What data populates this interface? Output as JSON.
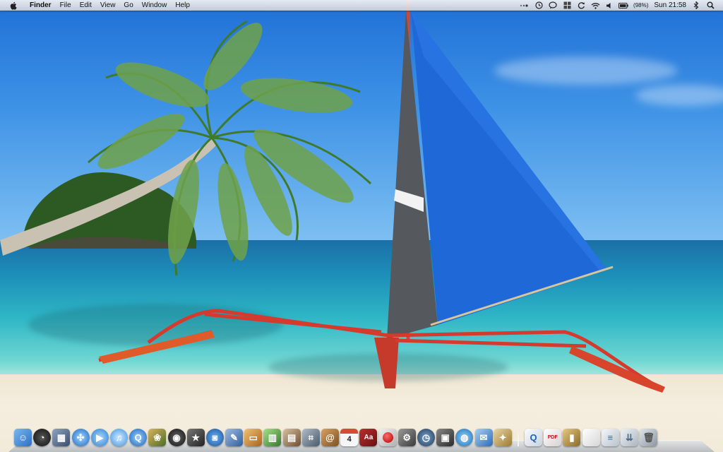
{
  "menubar": {
    "apple_icon": "apple-logo-icon",
    "app_name": "Finder",
    "menus": [
      "File",
      "Edit",
      "View",
      "Go",
      "Window",
      "Help"
    ],
    "status": {
      "battery_percent": "(98%)",
      "clock": "Sun 21:58",
      "icons": [
        "time-machine-icon",
        "chat-bubble-icon",
        "grid-icon",
        "sync-icon",
        "wifi-icon",
        "volume-icon",
        "battery-icon",
        "bluetooth-icon",
        "spotlight-search-icon"
      ]
    }
  },
  "wallpaper": {
    "description_icon": "beach-sailboat-wallpaper"
  },
  "dock": {
    "apps": [
      {
        "name": "finder",
        "icon": "finder-icon",
        "color": "#4a90d9"
      },
      {
        "name": "dashboard",
        "icon": "dashboard-icon",
        "color": "#2b2b2b"
      },
      {
        "name": "mission-control",
        "icon": "mission-control-icon",
        "color": "#5a6e8a"
      },
      {
        "name": "safari",
        "icon": "safari-icon",
        "color": "#3a8fd6"
      },
      {
        "name": "facetime",
        "icon": "facetime-icon",
        "color": "#4aa3e0"
      },
      {
        "name": "itunes",
        "icon": "itunes-icon",
        "color": "#53a6e8"
      },
      {
        "name": "quicktime",
        "icon": "quicktime-icon",
        "color": "#2a7fd0"
      },
      {
        "name": "iphoto",
        "icon": "iphoto-icon",
        "color": "#5b7f3a"
      },
      {
        "name": "aperture",
        "icon": "aperture-icon",
        "color": "#222222"
      },
      {
        "name": "imovie",
        "icon": "imovie-icon",
        "color": "#3b3b3b"
      },
      {
        "name": "photo-booth",
        "icon": "photo-booth-icon",
        "color": "#2566b8"
      },
      {
        "name": "pages",
        "icon": "pages-icon",
        "color": "#3d6fb0"
      },
      {
        "name": "keynote",
        "icon": "keynote-icon",
        "color": "#c98030"
      },
      {
        "name": "numbers",
        "icon": "numbers-icon",
        "color": "#4f9b3c"
      },
      {
        "name": "preview",
        "icon": "preview-icon",
        "color": "#8c6b4a"
      },
      {
        "name": "image-capture",
        "icon": "image-capture-icon",
        "color": "#6a7a8a"
      },
      {
        "name": "address-book",
        "icon": "address-book-icon",
        "color": "#a8753a"
      },
      {
        "name": "calendar",
        "icon": "calendar-icon",
        "color": "#d64a3a",
        "label": "4"
      },
      {
        "name": "dictionary",
        "icon": "dictionary-icon",
        "color": "#8b1c1c",
        "label": "Aa"
      },
      {
        "name": "record",
        "icon": "record-icon",
        "color": "#b02020"
      },
      {
        "name": "system-preferences",
        "icon": "system-preferences-icon",
        "color": "#6b6b6b"
      },
      {
        "name": "time-machine",
        "icon": "time-machine-dock-icon",
        "color": "#3a5a7a"
      },
      {
        "name": "remote-desktop",
        "icon": "remote-desktop-icon",
        "color": "#4a4a4a"
      },
      {
        "name": "network-globe",
        "icon": "globe-icon",
        "color": "#2f7fc0"
      },
      {
        "name": "mail",
        "icon": "mail-icon",
        "color": "#4b8ad0"
      },
      {
        "name": "app-store",
        "icon": "app-store-icon",
        "color": "#c0a060"
      }
    ],
    "docs": [
      {
        "name": "quicktime-doc",
        "icon": "quicktime-doc-icon",
        "color": "#dfe6ee"
      },
      {
        "name": "pdf-doc",
        "icon": "pdf-doc-icon",
        "color": "#e8e0e0",
        "label": "PDF"
      },
      {
        "name": "archive-doc",
        "icon": "archive-doc-icon",
        "color": "#c7a35c"
      },
      {
        "name": "blank-doc",
        "icon": "blank-doc-icon",
        "color": "#f2f2f2"
      },
      {
        "name": "web-doc",
        "icon": "web-doc-icon",
        "color": "#e6eaf0"
      },
      {
        "name": "downloads-stack",
        "icon": "downloads-stack-icon",
        "color": "#dde3ea"
      },
      {
        "name": "trash",
        "icon": "trash-icon",
        "color": "#b5bcc4"
      }
    ]
  }
}
